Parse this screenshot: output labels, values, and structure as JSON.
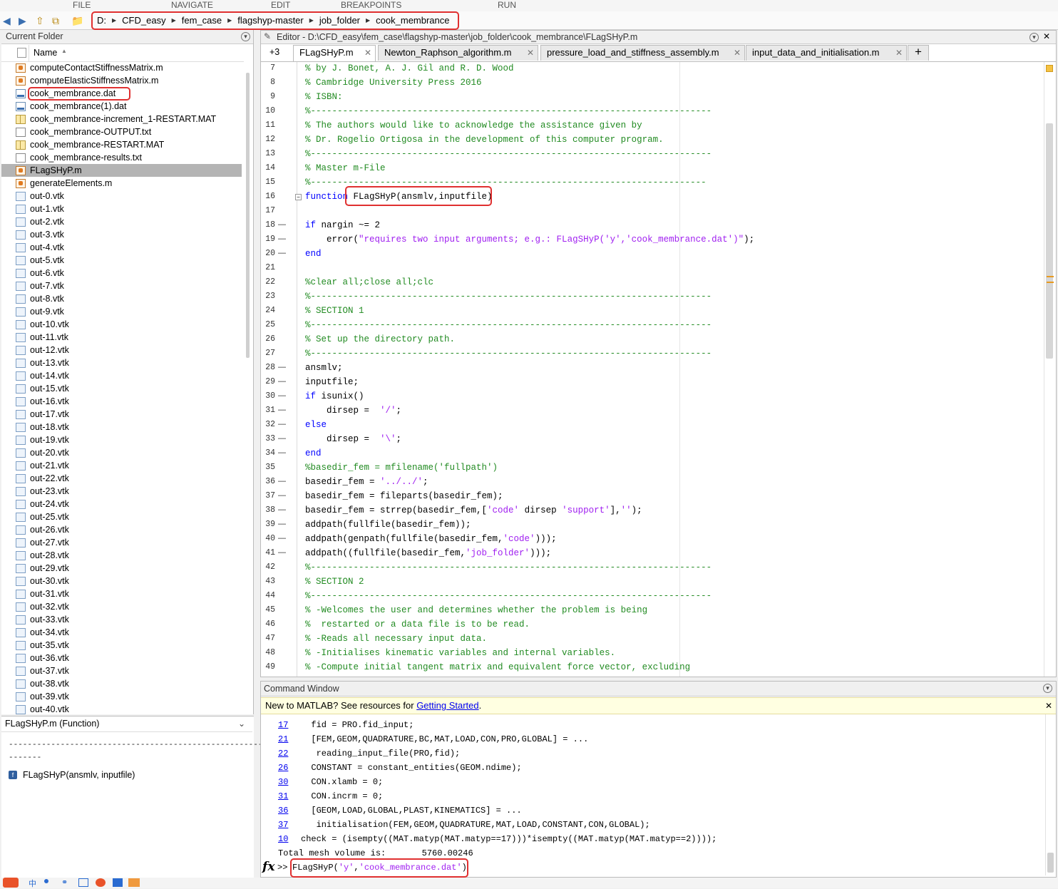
{
  "ribbon": {
    "tabs": [
      "FILE",
      "NAVIGATE",
      "EDIT",
      "BREAKPOINTS",
      "RUN"
    ]
  },
  "address": {
    "crumbs": [
      "D:",
      "CFD_easy",
      "fem_case",
      "flagshyp-master",
      "job_folder",
      "cook_membrance"
    ]
  },
  "current_folder": {
    "title": "Current Folder",
    "column_name": "Name",
    "files": [
      {
        "name": "computeContactStiffnessMatrix.m",
        "type": "m"
      },
      {
        "name": "computeElasticStiffnessMatrix.m",
        "type": "m"
      },
      {
        "name": "cook_membrance.dat",
        "type": "dat"
      },
      {
        "name": "cook_membrance(1).dat",
        "type": "dat"
      },
      {
        "name": "cook_membrance-increment_1-RESTART.MAT",
        "type": "mat"
      },
      {
        "name": "cook_membrance-OUTPUT.txt",
        "type": "txt"
      },
      {
        "name": "cook_membrance-RESTART.MAT",
        "type": "mat"
      },
      {
        "name": "cook_membrance-results.txt",
        "type": "txt"
      },
      {
        "name": "FLagSHyP.m",
        "type": "m",
        "selected": true
      },
      {
        "name": "generateElements.m",
        "type": "m"
      },
      {
        "name": "out-0.vtk",
        "type": "vtk"
      },
      {
        "name": "out-1.vtk",
        "type": "vtk"
      },
      {
        "name": "out-2.vtk",
        "type": "vtk"
      },
      {
        "name": "out-3.vtk",
        "type": "vtk"
      },
      {
        "name": "out-4.vtk",
        "type": "vtk"
      },
      {
        "name": "out-5.vtk",
        "type": "vtk"
      },
      {
        "name": "out-6.vtk",
        "type": "vtk"
      },
      {
        "name": "out-7.vtk",
        "type": "vtk"
      },
      {
        "name": "out-8.vtk",
        "type": "vtk"
      },
      {
        "name": "out-9.vtk",
        "type": "vtk"
      },
      {
        "name": "out-10.vtk",
        "type": "vtk"
      },
      {
        "name": "out-11.vtk",
        "type": "vtk"
      },
      {
        "name": "out-12.vtk",
        "type": "vtk"
      },
      {
        "name": "out-13.vtk",
        "type": "vtk"
      },
      {
        "name": "out-14.vtk",
        "type": "vtk"
      },
      {
        "name": "out-15.vtk",
        "type": "vtk"
      },
      {
        "name": "out-16.vtk",
        "type": "vtk"
      },
      {
        "name": "out-17.vtk",
        "type": "vtk"
      },
      {
        "name": "out-18.vtk",
        "type": "vtk"
      },
      {
        "name": "out-19.vtk",
        "type": "vtk"
      },
      {
        "name": "out-20.vtk",
        "type": "vtk"
      },
      {
        "name": "out-21.vtk",
        "type": "vtk"
      },
      {
        "name": "out-22.vtk",
        "type": "vtk"
      },
      {
        "name": "out-23.vtk",
        "type": "vtk"
      },
      {
        "name": "out-24.vtk",
        "type": "vtk"
      },
      {
        "name": "out-25.vtk",
        "type": "vtk"
      },
      {
        "name": "out-26.vtk",
        "type": "vtk"
      },
      {
        "name": "out-27.vtk",
        "type": "vtk"
      },
      {
        "name": "out-28.vtk",
        "type": "vtk"
      },
      {
        "name": "out-29.vtk",
        "type": "vtk"
      },
      {
        "name": "out-30.vtk",
        "type": "vtk"
      },
      {
        "name": "out-31.vtk",
        "type": "vtk"
      },
      {
        "name": "out-32.vtk",
        "type": "vtk"
      },
      {
        "name": "out-33.vtk",
        "type": "vtk"
      },
      {
        "name": "out-34.vtk",
        "type": "vtk"
      },
      {
        "name": "out-35.vtk",
        "type": "vtk"
      },
      {
        "name": "out-36.vtk",
        "type": "vtk"
      },
      {
        "name": "out-37.vtk",
        "type": "vtk"
      },
      {
        "name": "out-38.vtk",
        "type": "vtk"
      },
      {
        "name": "out-39.vtk",
        "type": "vtk"
      },
      {
        "name": "out-40.vtk",
        "type": "vtk"
      }
    ]
  },
  "details": {
    "header": "FLagSHyP.m  (Function)",
    "separator": "-----------------------------------------------------------------------",
    "separator2": "-------",
    "signature": "FLagSHyP(ansmlv, inputfile)"
  },
  "editor": {
    "title": "Editor - D:\\CFD_easy\\fem_case\\flagshyp-master\\job_folder\\cook_membrance\\FLagSHyP.m",
    "more_tabs": "+3",
    "tabs": [
      "FLagSHyP.m",
      "Newton_Raphson_algorithm.m",
      "pressure_load_and_stiffness_assembly.m",
      "input_data_and_initialisation.m"
    ],
    "add_tab": "+",
    "lines": [
      {
        "n": "7",
        "t": "% by J. Bonet, A. J. Gil and R. D. Wood",
        "s": "com"
      },
      {
        "n": "8",
        "t": "% Cambridge University Press 2016",
        "s": "com"
      },
      {
        "n": "9",
        "t": "% ISBN:",
        "s": "com"
      },
      {
        "n": "10",
        "t": "%---------------------------------------------------------------------------",
        "s": "com"
      },
      {
        "n": "11",
        "t": "% The authors would like to acknowledge the assistance given by",
        "s": "com"
      },
      {
        "n": "12",
        "t": "% Dr. Rogelio Ortigosa in the development of this computer program.",
        "s": "com"
      },
      {
        "n": "13",
        "t": "%---------------------------------------------------------------------------",
        "s": "com"
      },
      {
        "n": "14",
        "t": "% Master m-File",
        "s": "com"
      },
      {
        "n": "15",
        "t": "%--------------------------------------------------------------------------",
        "s": "com"
      },
      {
        "n": "16",
        "t": "function FLagSHyP(ansmlv,inputfile)",
        "s": "fn"
      },
      {
        "n": "17",
        "t": "",
        "s": ""
      },
      {
        "n": "18",
        "t": "if nargin ~= 2",
        "s": "if",
        "d": "—"
      },
      {
        "n": "19",
        "t": "    error(\"requires two input arguments; e.g.: FLagSHyP('y','cook_membrance.dat')\");",
        "s": "err",
        "d": "—"
      },
      {
        "n": "20",
        "t": "end",
        "s": "kw",
        "d": "—"
      },
      {
        "n": "21",
        "t": "",
        "s": ""
      },
      {
        "n": "22",
        "t": "%clear all;close all;clc",
        "s": "com"
      },
      {
        "n": "23",
        "t": "%---------------------------------------------------------------------------",
        "s": "com"
      },
      {
        "n": "24",
        "t": "% SECTION 1",
        "s": "com"
      },
      {
        "n": "25",
        "t": "%---------------------------------------------------------------------------",
        "s": "com"
      },
      {
        "n": "26",
        "t": "% Set up the directory path.",
        "s": "com"
      },
      {
        "n": "27",
        "t": "%---------------------------------------------------------------------------",
        "s": "com"
      },
      {
        "n": "28",
        "t": "ansmlv;",
        "s": "",
        "d": "—"
      },
      {
        "n": "29",
        "t": "inputfile;",
        "s": "",
        "d": "—"
      },
      {
        "n": "30",
        "t": "if isunix()",
        "s": "if",
        "d": "—"
      },
      {
        "n": "31",
        "t": "    dirsep =  '/';",
        "s": "str1",
        "d": "—"
      },
      {
        "n": "32",
        "t": "else",
        "s": "kw",
        "d": "—"
      },
      {
        "n": "33",
        "t": "    dirsep =  '\\';",
        "s": "str1",
        "d": "—"
      },
      {
        "n": "34",
        "t": "end",
        "s": "kw",
        "d": "—"
      },
      {
        "n": "35",
        "t": "%basedir_fem = mfilename('fullpath')",
        "s": "com"
      },
      {
        "n": "36",
        "t": "basedir_fem = '../../';",
        "s": "str1",
        "d": "—"
      },
      {
        "n": "37",
        "t": "basedir_fem = fileparts(basedir_fem);",
        "s": "",
        "d": "—"
      },
      {
        "n": "38",
        "t": "basedir_fem = strrep(basedir_fem,['code' dirsep 'support'],'');",
        "s": "",
        "d": "—"
      },
      {
        "n": "39",
        "t": "addpath(fullfile(basedir_fem));",
        "s": "",
        "d": "—"
      },
      {
        "n": "40",
        "t": "addpath(genpath(fullfile(basedir_fem,'code')));",
        "s": "",
        "d": "—"
      },
      {
        "n": "41",
        "t": "addpath((fullfile(basedir_fem,'job_folder')));",
        "s": "",
        "d": "—"
      },
      {
        "n": "42",
        "t": "%---------------------------------------------------------------------------",
        "s": "com"
      },
      {
        "n": "43",
        "t": "% SECTION 2",
        "s": "com"
      },
      {
        "n": "44",
        "t": "%---------------------------------------------------------------------------",
        "s": "com"
      },
      {
        "n": "45",
        "t": "% -Welcomes the user and determines whether the problem is being",
        "s": "com"
      },
      {
        "n": "46",
        "t": "%  restarted or a data file is to be read.",
        "s": "com"
      },
      {
        "n": "47",
        "t": "% -Reads all necessary input data.",
        "s": "com"
      },
      {
        "n": "48",
        "t": "% -Initialises kinematic variables and internal variables.",
        "s": "com"
      },
      {
        "n": "49",
        "t": "% -Compute initial tangent matrix and equivalent force vector, excluding",
        "s": "com"
      }
    ]
  },
  "command_window": {
    "title": "Command Window",
    "notice_text": "New to MATLAB? See resources for ",
    "notice_link": "Getting Started",
    "notice_end": ".",
    "history": [
      {
        "n": "17",
        "t": "  fid = PRO.fid_input;"
      },
      {
        "n": "21",
        "t": "  [FEM,GEOM,QUADRATURE,BC,MAT,LOAD,CON,PRO,GLOBAL] = ..."
      },
      {
        "n": "22",
        "t": "   reading_input_file(PRO,fid);"
      },
      {
        "n": "26",
        "t": "  CONSTANT = constant_entities(GEOM.ndime);"
      },
      {
        "n": "30",
        "t": "  CON.xlamb = 0;"
      },
      {
        "n": "31",
        "t": "  CON.incrm = 0;"
      },
      {
        "n": "36",
        "t": "  [GEOM,LOAD,GLOBAL,PLAST,KINEMATICS] = ..."
      },
      {
        "n": "37",
        "t": "   initialisation(FEM,GEOM,QUADRATURE,MAT,LOAD,CONSTANT,CON,GLOBAL);"
      },
      {
        "n": "10",
        "t": "check = (isempty((MAT.matyp(MAT.matyp==17)))*isempty((MAT.matyp(MAT.matyp==2))));"
      }
    ],
    "result": "Total mesh volume is:       5760.00246",
    "prompt": ">>",
    "input": "FLagSHyP('y','cook_membrance.dat')"
  }
}
